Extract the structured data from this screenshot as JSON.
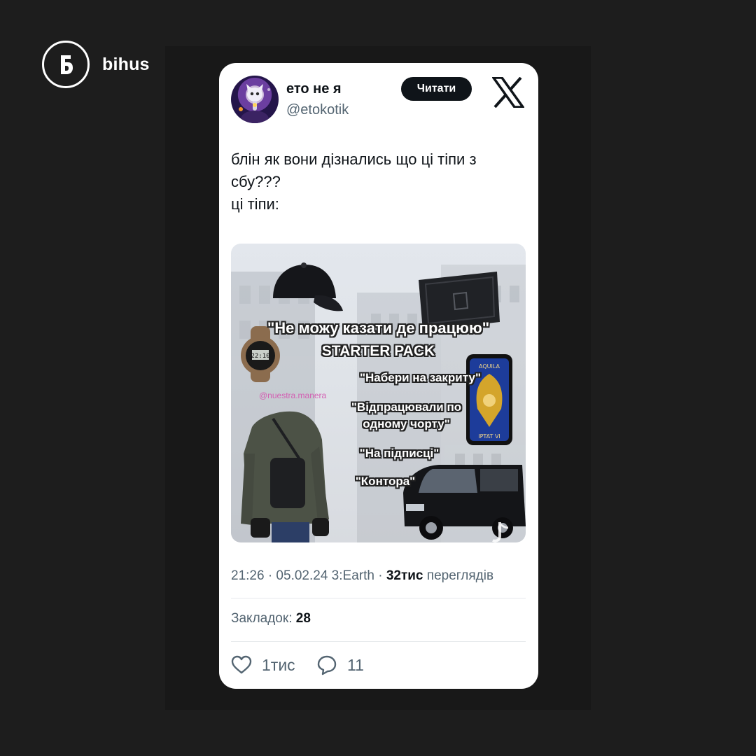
{
  "brand": {
    "name": "bihus",
    "logo_glyph": "Б"
  },
  "tweet": {
    "author": {
      "display_name": "ето не я",
      "handle": "@etokotik",
      "follow_label": "Читати"
    },
    "text_lines": [
      "блін як вони дізнались що ці тіпи з",
      "сбу???",
      "ці тіпи:"
    ],
    "media": {
      "meme_lines": [
        "\"Не можу казати де працюю\"",
        "STARTER PACK",
        "\"Набери на закриту\"",
        "\"Відпрацювали по",
        "одному чорту\"",
        "\"На підписці\"",
        "\"Контора\""
      ],
      "watermark": "@nuestra.manera",
      "watch_display": "22:10",
      "badge_top": "AQUILA",
      "badge_bottom": "IPTAT VI"
    },
    "meta": {
      "time_date": "21:26 · 05.02.24 3:Earth · ",
      "views_count": "32тис",
      "views_label": " переглядів"
    },
    "bookmarks": {
      "label": "Закладок: ",
      "count": "28"
    },
    "actions": {
      "likes": "1тис",
      "replies": "11"
    }
  },
  "colors": {
    "background": "#1d1d1d",
    "card": "#ffffff",
    "text_primary": "#0f1419",
    "text_secondary": "#536471"
  },
  "icons": {
    "brand": "bihus-logo-icon",
    "x": "x-logo-icon",
    "like": "heart-icon",
    "reply": "speech-bubble-icon"
  }
}
